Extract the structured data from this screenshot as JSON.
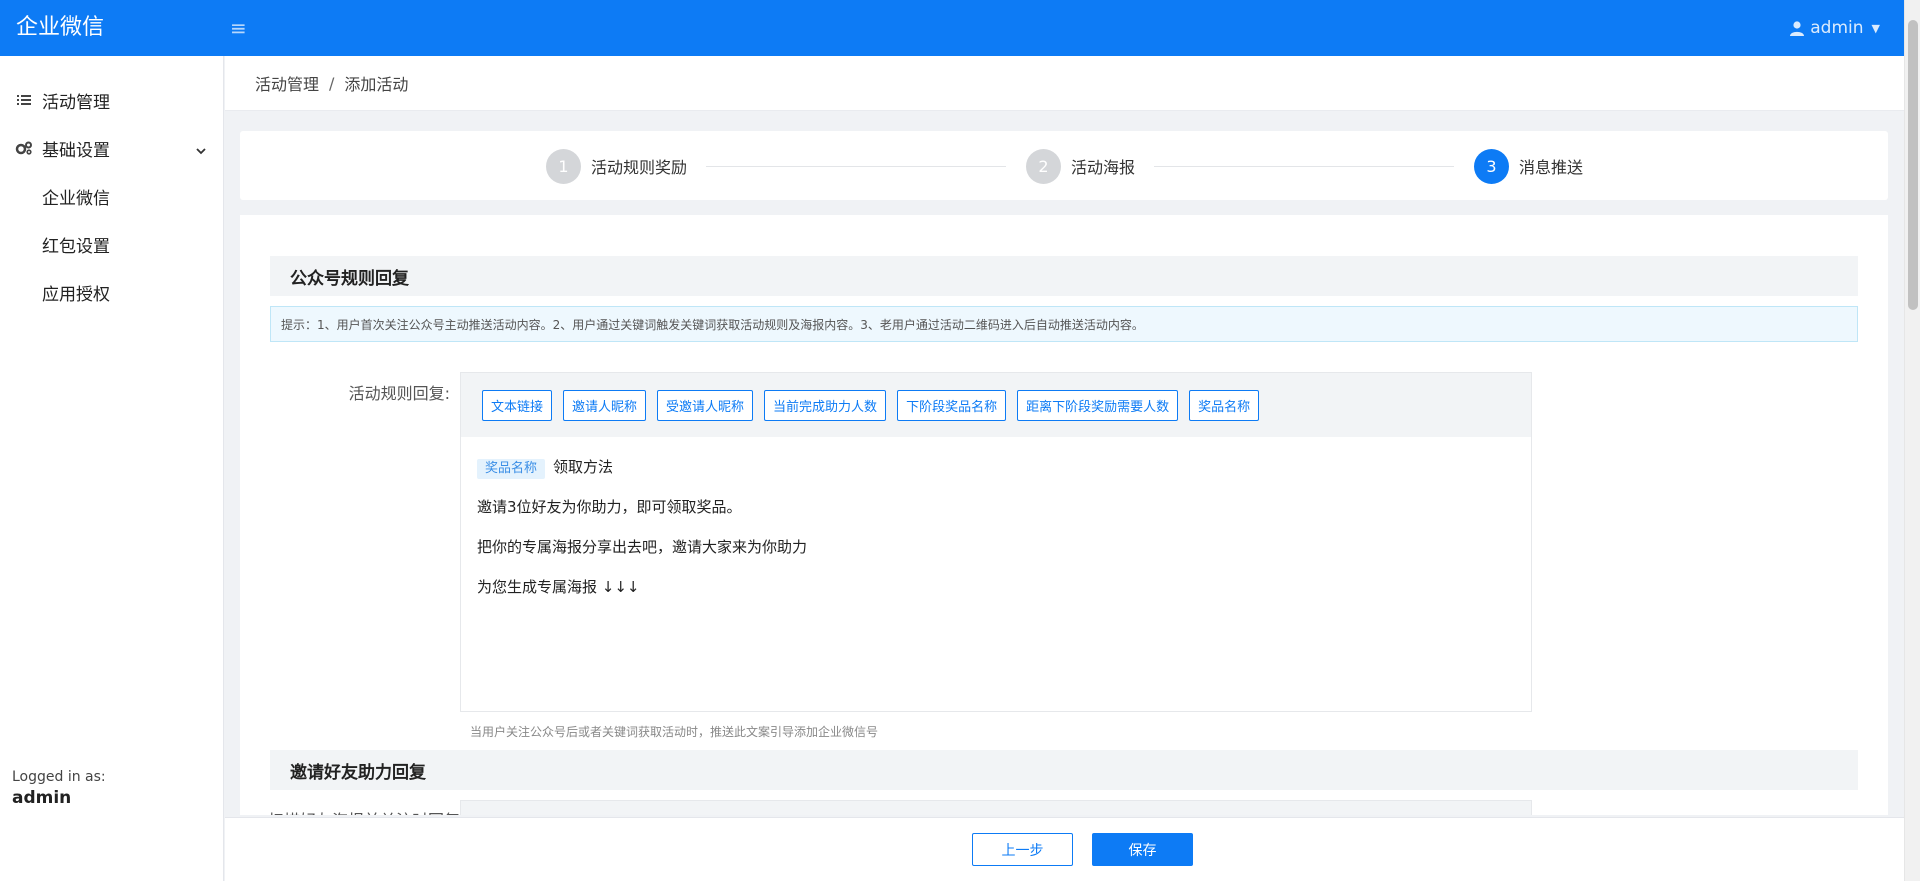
{
  "header": {
    "brand": "企业微信",
    "toggle_icon": "hamburger-icon",
    "user_name": "admin"
  },
  "sidebar": {
    "items": [
      {
        "label": "活动管理",
        "icon": "list-icon"
      },
      {
        "label": "基础设置",
        "icon": "cogs-icon",
        "expanded": true
      },
      {
        "label": "企业微信"
      },
      {
        "label": "红包设置"
      },
      {
        "label": "应用授权"
      }
    ],
    "logged_in_label": "Logged in as:",
    "logged_in_user": "admin"
  },
  "breadcrumb": {
    "parent": "活动管理",
    "separator": "/",
    "current": "添加活动"
  },
  "steps": [
    {
      "num": "1",
      "label": "活动规则奖励",
      "active": false
    },
    {
      "num": "2",
      "label": "活动海报",
      "active": false
    },
    {
      "num": "3",
      "label": "消息推送",
      "active": true
    }
  ],
  "section1": {
    "title": "公众号规则回复",
    "hint": "提示：1、用户首次关注公众号主动推送活动内容。2、用户通过关键词触发关键词获取活动规则及海报内容。3、老用户通过活动二维码进入后自动推送活动内容。",
    "field_label": "活动规则回复:",
    "toolbar": [
      "文本链接",
      "邀请人昵称",
      "受邀请人昵称",
      "当前完成助力人数",
      "下阶段奖品名称",
      "距离下阶段奖励需要人数",
      "奖品名称"
    ],
    "content": {
      "var_tag": "奖品名称",
      "line1_text": "领取方法",
      "line2": "邀请3位好友为你助力，即可领取奖品。",
      "line3": "把你的专属海报分享出去吧，邀请大家来为你助力",
      "line4": "为您生成专属海报 ↓↓↓"
    },
    "help": "当用户关注公众号后或者关键词获取活动时，推送此文案引导添加企业微信号"
  },
  "section2": {
    "title": "邀请好友助力回复",
    "field_label_partial": "扫描好友海报并关注时回复"
  },
  "footer": {
    "prev": "上一步",
    "save": "保存"
  },
  "colors": {
    "primary": "#0d7bf5",
    "step_inactive": "#d4d6d9",
    "hint_bg": "#eef8fe"
  }
}
